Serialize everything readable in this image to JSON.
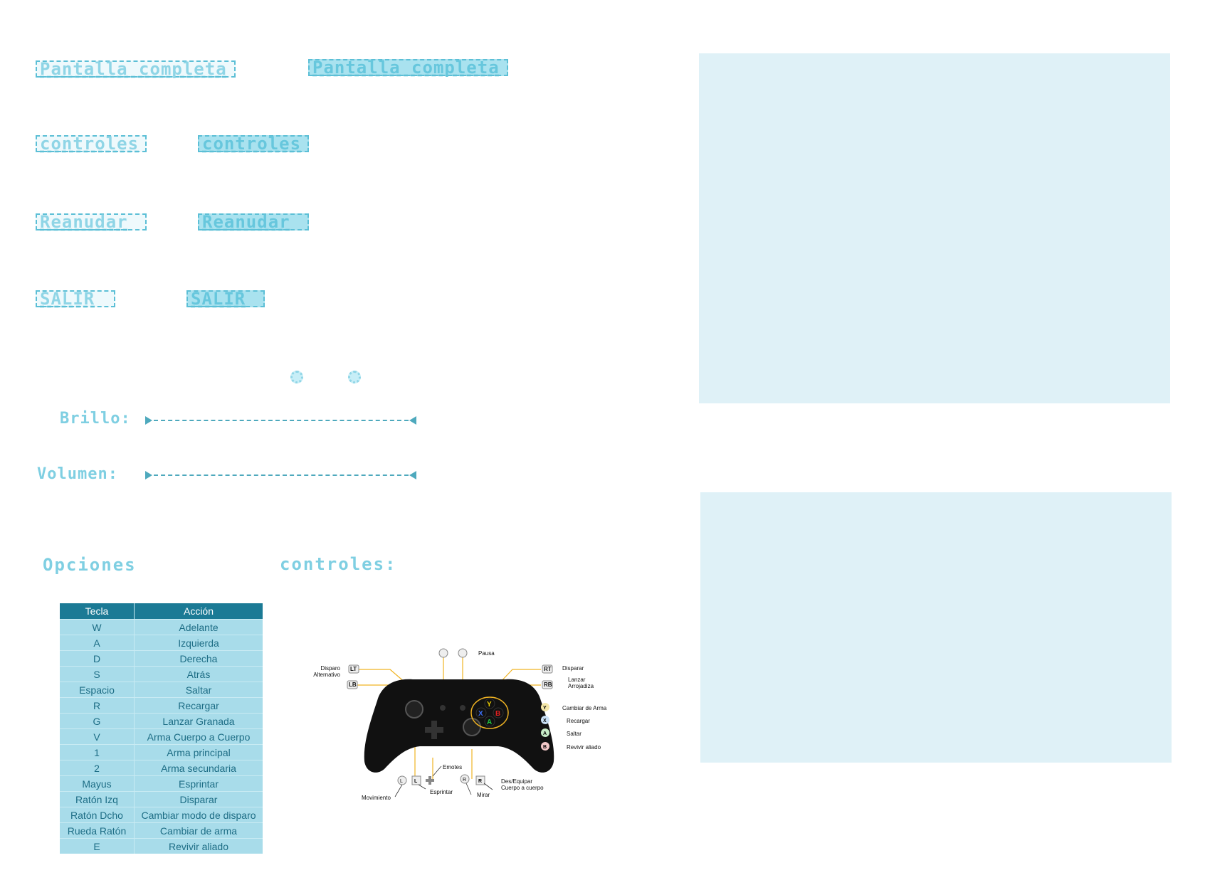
{
  "menu": {
    "fullscreen": "Pantalla completa",
    "controls": "controles",
    "resume": "Reanudar",
    "exit": "SALIR"
  },
  "sliders": {
    "brightness_label": "Brillo:",
    "volume_label": "Volumen:"
  },
  "headings": {
    "options": "Opciones",
    "controls": "controles:"
  },
  "keys_table": {
    "headers": [
      "Tecla",
      "Acción"
    ],
    "rows": [
      [
        "W",
        "Adelante"
      ],
      [
        "A",
        "Izquierda"
      ],
      [
        "D",
        "Derecha"
      ],
      [
        "S",
        "Atrás"
      ],
      [
        "Espacio",
        "Saltar"
      ],
      [
        "R",
        "Recargar"
      ],
      [
        "G",
        "Lanzar Granada"
      ],
      [
        "V",
        "Arma Cuerpo a Cuerpo"
      ],
      [
        "1",
        "Arma principal"
      ],
      [
        "2",
        "Arma secundaria"
      ],
      [
        "Mayus",
        "Esprintar"
      ],
      [
        "Ratón Izq",
        "Disparar"
      ],
      [
        "Ratón Dcho",
        "Cambiar modo de disparo"
      ],
      [
        "Rueda Ratón",
        "Cambiar de arma"
      ],
      [
        "E",
        "Revivir aliado"
      ]
    ]
  },
  "controller": {
    "lt": "LT",
    "lb": "LB",
    "rt": "RT",
    "rb": "RB",
    "lt_action": "Disparo Alternativo",
    "rt_action": "Disparar",
    "rb_action": "Lanzar Arrojadiza",
    "pause": "Pausa",
    "y_action": "Cambiar de Arma",
    "x_action": "Recargar",
    "a_action": "Saltar",
    "b_action": "Revivir aliado",
    "emotes": "Emotes",
    "sprint": "Esprintar",
    "move": "Movimiento",
    "look": "Mirar",
    "melee": "Des/Equipar Cuerpo a cuerpo",
    "l": "L",
    "r": "R",
    "y": "Y",
    "x": "X",
    "a": "A",
    "b": "B"
  },
  "colors": {
    "accent": "#8fd5e6",
    "panel": "#dff1f7",
    "table_header": "#1b7a95",
    "table_cell": "#a8dcea"
  }
}
